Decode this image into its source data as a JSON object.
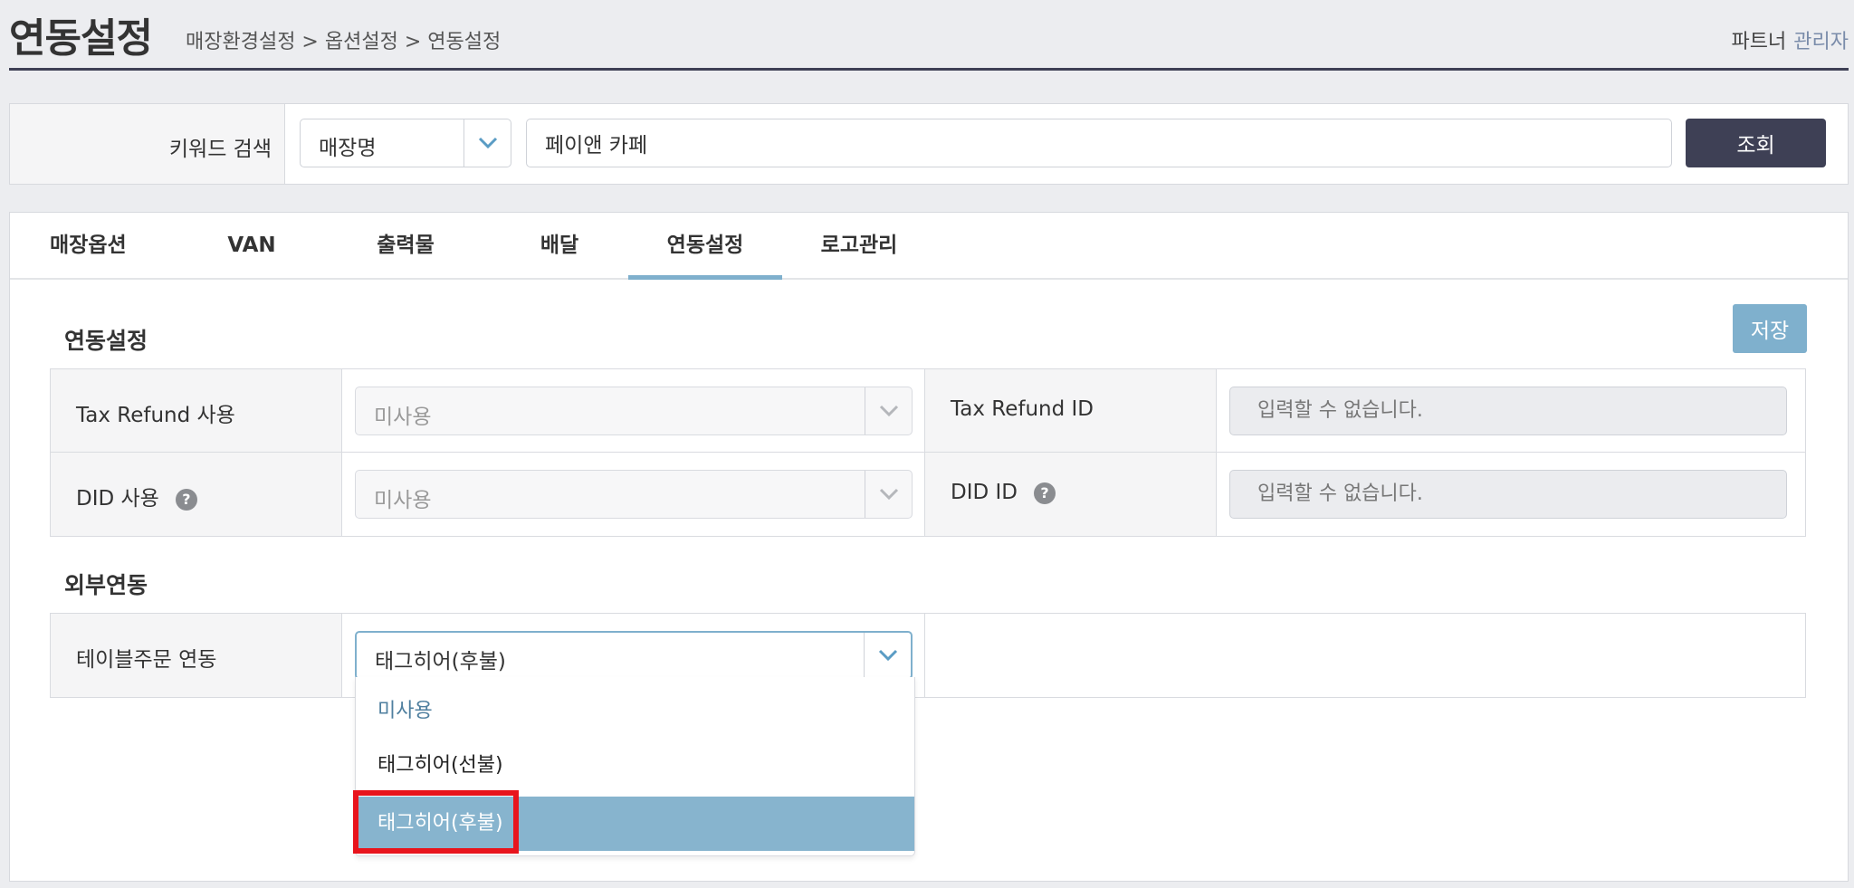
{
  "header": {
    "title": "연동설정",
    "breadcrumb": "매장환경설정 > 옵션설정 > 연동설정",
    "user_name": "파트너",
    "user_role": "관리자"
  },
  "search": {
    "label": "키워드 검색",
    "type_value": "매장명",
    "keyword_value": "페이앤 카페",
    "button_label": "조회"
  },
  "tabs": [
    {
      "label": "매장옵션"
    },
    {
      "label": "VAN"
    },
    {
      "label": "출력물"
    },
    {
      "label": "배달"
    },
    {
      "label": "연동설정"
    },
    {
      "label": "로고관리"
    }
  ],
  "integration": {
    "section_title": "연동설정",
    "save_label": "저장",
    "tax_refund_use_label": "Tax Refund 사용",
    "tax_refund_use_value": "미사용",
    "tax_refund_id_label": "Tax Refund ID",
    "tax_refund_id_value": "입력할 수 없습니다.",
    "did_use_label": "DID 사용",
    "did_use_value": "미사용",
    "did_id_label": "DID ID",
    "did_id_value": "입력할 수 없습니다.",
    "help_glyph": "?"
  },
  "external": {
    "section_title": "외부연동",
    "table_order_label": "테이블주문 연동",
    "table_order_value": "태그히어(후불)",
    "options": [
      "미사용",
      "태그히어(선불)",
      "태그히어(후불)"
    ]
  },
  "colors": {
    "accent": "#7fb0cd",
    "dark_button": "#3e4055",
    "selected_option": "#87b4ce",
    "highlight": "#e8141c"
  }
}
